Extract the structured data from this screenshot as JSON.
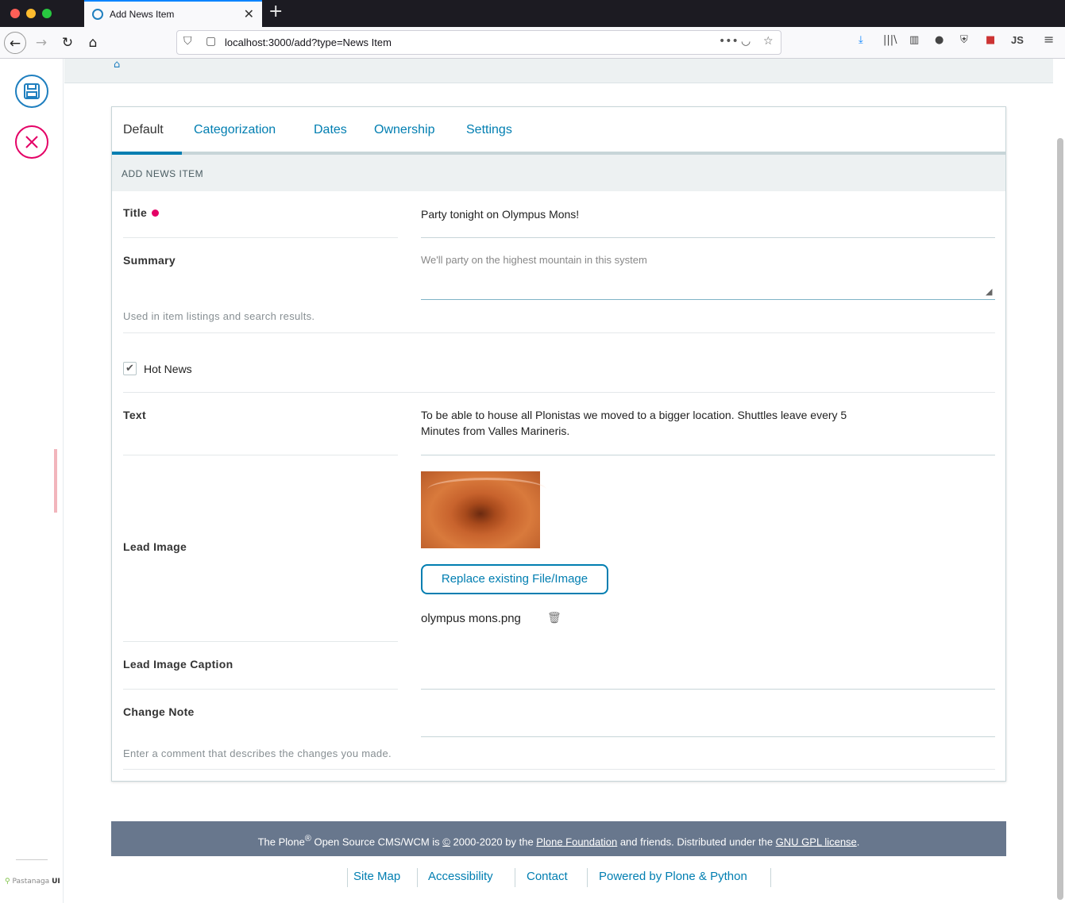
{
  "browser": {
    "tab_title": "Add News Item",
    "url": "localhost:3000/add?type=News Item",
    "new_tab_symbol": "+",
    "close_symbol": "✕",
    "profile_label": "JS"
  },
  "page": {
    "tabs": [
      {
        "label": "Default"
      },
      {
        "label": "Categorization"
      },
      {
        "label": "Dates"
      },
      {
        "label": "Ownership"
      },
      {
        "label": "Settings"
      }
    ],
    "section_title": "ADD NEWS ITEM",
    "fields": {
      "title": {
        "label": "Title",
        "value": "Party tonight on Olympus Mons!"
      },
      "summary": {
        "label": "Summary",
        "value": "We'll party on the highest mountain in this system",
        "help": "Used in item listings and search results."
      },
      "hot_news": {
        "label": "Hot News",
        "checked": true
      },
      "text": {
        "label": "Text",
        "value_line1": "To be able to house all Plonistas we moved to a bigger location. Shuttles leave every 5",
        "value_line2": "Minutes from Valles Marineris."
      },
      "lead_image": {
        "label": "Lead Image",
        "replace_label": "Replace existing File/Image",
        "filename": "olympus mons.png"
      },
      "lead_image_caption": {
        "label": "Lead Image Caption"
      },
      "change_note": {
        "label": "Change Note",
        "help": "Enter a comment that describes the changes you made."
      }
    }
  },
  "sidebar": {
    "brand": "Pastanaga",
    "brand_suffix": "UI"
  },
  "footer": {
    "text_part1": "The Plone",
    "registered": "®",
    "text_part2": " Open Source CMS/WCM is ",
    "copyright": "©",
    "text_part3": " 2000-2020 by the ",
    "foundation_link": "Plone Foundation",
    "text_part4": " and friends. Distributed under the ",
    "license_link": "GNU GPL license",
    "text_part5": ".",
    "links": [
      {
        "label": "Site Map"
      },
      {
        "label": "Accessibility"
      },
      {
        "label": "Contact"
      },
      {
        "label": "Powered by Plone & Python"
      }
    ]
  },
  "colors": {
    "accent": "#007eb1",
    "required": "#e40166",
    "cancel": "#e40166",
    "footer_band": "#68778d"
  }
}
